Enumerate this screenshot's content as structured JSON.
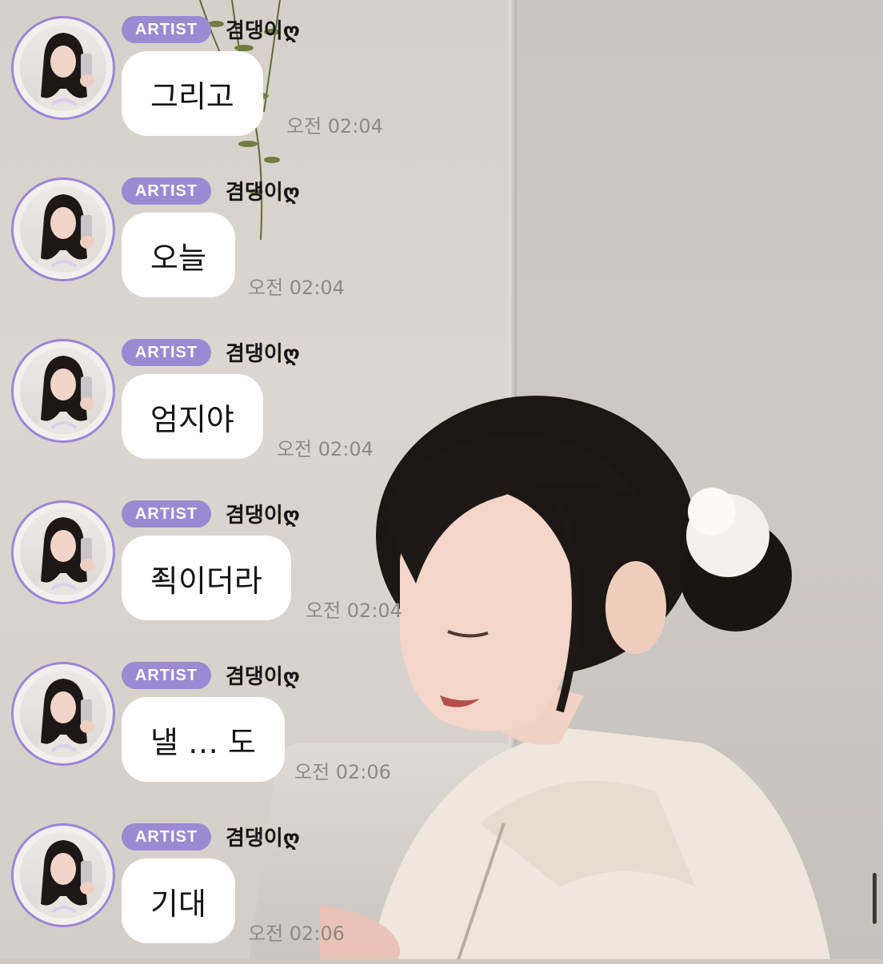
{
  "messages": [
    {
      "badge": "ARTIST",
      "sender": "겸댕이ღ",
      "text": "그리고",
      "time": "오전 02:04"
    },
    {
      "badge": "ARTIST",
      "sender": "겸댕이ღ",
      "text": "오늘",
      "time": "오전 02:04"
    },
    {
      "badge": "ARTIST",
      "sender": "겸댕이ღ",
      "text": "엄지야",
      "time": "오전 02:04"
    },
    {
      "badge": "ARTIST",
      "sender": "겸댕이ღ",
      "text": "죅이더라",
      "time": "오전 02:04"
    },
    {
      "badge": "ARTIST",
      "sender": "겸댕이ღ",
      "text": "낼 … 도",
      "time": "오전 02:06"
    },
    {
      "badge": "ARTIST",
      "sender": "겸댕이ღ",
      "text": "기대",
      "time": "오전 02:06"
    }
  ],
  "colors": {
    "badge": "#9c89d3",
    "avatar_ring": "#9b86d6",
    "bubble": "#ffffff",
    "time_text": "#8e8a87"
  }
}
